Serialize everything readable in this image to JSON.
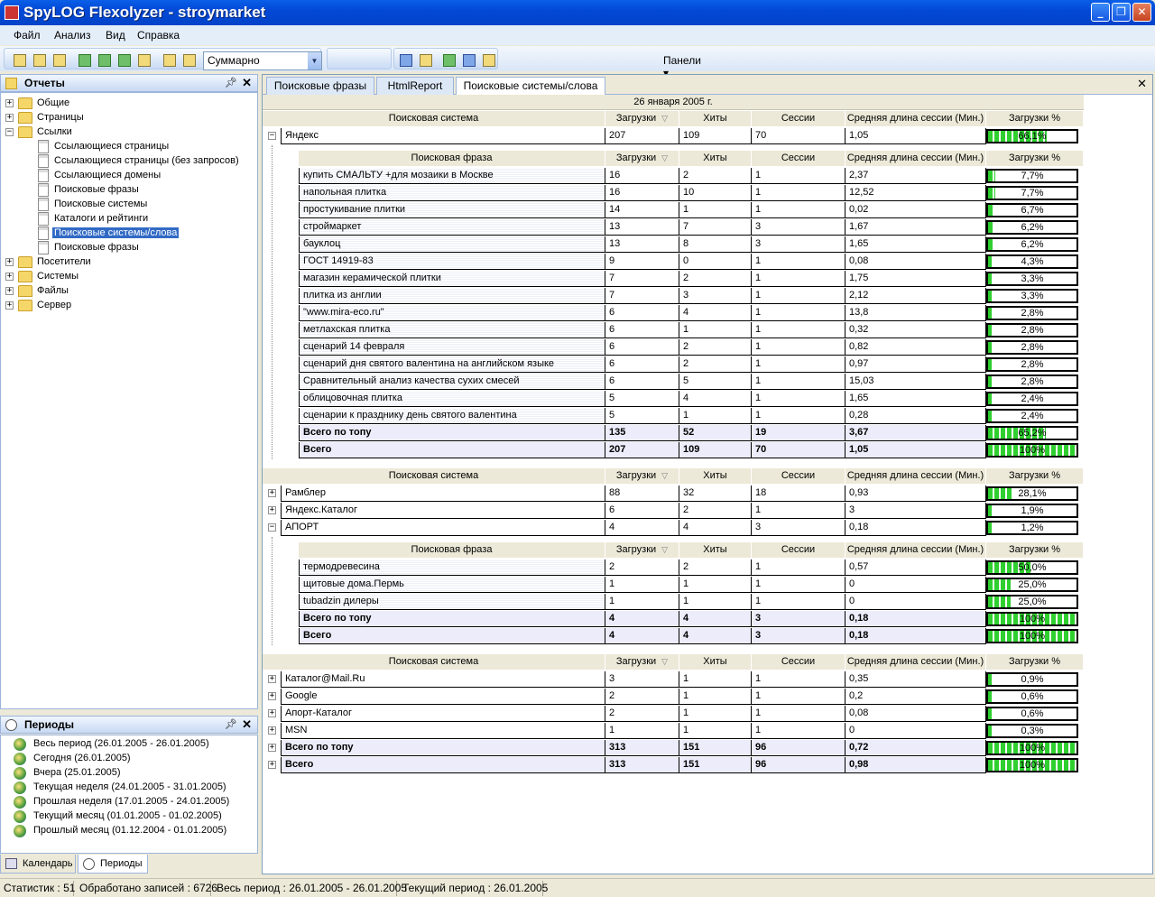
{
  "window": {
    "title": "SpyLOG Flexolyzer - stroymarket",
    "min": "_",
    "max": "❐",
    "close": "✕"
  },
  "menu": [
    "Файл",
    "Анализ",
    "Вид",
    "Справка"
  ],
  "toolbar": {
    "combo_value": "Суммарно",
    "panels_label": "Панели"
  },
  "reports_panel": {
    "title": "Отчеты",
    "tree": [
      {
        "label": "Общие",
        "level": 0,
        "type": "folder",
        "exp": "+"
      },
      {
        "label": "Страницы",
        "level": 0,
        "type": "folder",
        "exp": "+"
      },
      {
        "label": "Ссылки",
        "level": 0,
        "type": "folder",
        "exp": "−"
      },
      {
        "label": "Ссылающиеся страницы",
        "level": 1,
        "type": "doc"
      },
      {
        "label": "Ссылающиеся страницы (без запросов)",
        "level": 1,
        "type": "doc"
      },
      {
        "label": "Ссылающиеся домены",
        "level": 1,
        "type": "doc"
      },
      {
        "label": "Поисковые фразы",
        "level": 1,
        "type": "doc"
      },
      {
        "label": "Поисковые системы",
        "level": 1,
        "type": "doc"
      },
      {
        "label": "Каталоги и рейтинги",
        "level": 1,
        "type": "doc"
      },
      {
        "label": "Поисковые системы/слова",
        "level": 1,
        "type": "doc",
        "selected": true
      },
      {
        "label": "Поисковые фразы",
        "level": 1,
        "type": "doc"
      },
      {
        "label": "Посетители",
        "level": 0,
        "type": "folder",
        "exp": "+"
      },
      {
        "label": "Системы",
        "level": 0,
        "type": "folder",
        "exp": "+"
      },
      {
        "label": "Файлы",
        "level": 0,
        "type": "folder",
        "exp": "+"
      },
      {
        "label": "Сервер",
        "level": 0,
        "type": "folder",
        "exp": "+"
      }
    ]
  },
  "periods_panel": {
    "title": "Периоды",
    "items": [
      "Весь период (26.01.2005 - 26.01.2005)",
      "Сегодня (26.01.2005)",
      "Вчера (25.01.2005)",
      "Текущая неделя (24.01.2005 - 31.01.2005)",
      "Прошлая неделя (17.01.2005 - 24.01.2005)",
      "Текущий месяц (01.01.2005 - 01.02.2005)",
      "Прошлый месяц (01.12.2004 - 01.01.2005)"
    ]
  },
  "bottom_tabs": [
    "Календарь",
    "Периоды"
  ],
  "doc_tabs": [
    "Поисковые фразы",
    "HtmlReport",
    "Поисковые системы/слова"
  ],
  "report": {
    "date": "26 января 2005 г.",
    "headers_system": [
      "Поисковая система",
      "Загрузки",
      "Хиты",
      "Сессии",
      "Средняя длина сессии (Мин.)",
      "Загрузки %"
    ],
    "headers_phrase": [
      "Поисковая фраза",
      "Загрузки",
      "Хиты",
      "Сессии",
      "Средняя длина сессии (Мин.)",
      "Загрузки %"
    ],
    "sections": [
      {
        "systems": [
          {
            "name": "Яндекс",
            "loads": "207",
            "hits": "109",
            "sessions": "70",
            "avg": "1,05",
            "pct": "66,1%",
            "pct_value": 66.1,
            "exp": "−"
          }
        ],
        "phrases": [
          {
            "name": "купить СМАЛЬТУ +для мозаики в Москве",
            "loads": "16",
            "hits": "2",
            "sessions": "1",
            "avg": "2,37",
            "pct": "7,7%",
            "pct_value": 7.7
          },
          {
            "name": "напольная плитка",
            "loads": "16",
            "hits": "10",
            "sessions": "1",
            "avg": "12,52",
            "pct": "7,7%",
            "pct_value": 7.7
          },
          {
            "name": "простукивание плитки",
            "loads": "14",
            "hits": "1",
            "sessions": "1",
            "avg": "0,02",
            "pct": "6,7%",
            "pct_value": 6.7
          },
          {
            "name": "стройм​аркет",
            "loads": "13",
            "hits": "7",
            "sessions": "3",
            "avg": "1,67",
            "pct": "6,2%",
            "pct_value": 6.2
          },
          {
            "name": "бауклоц",
            "loads": "13",
            "hits": "8",
            "sessions": "3",
            "avg": "1,65",
            "pct": "6,2%",
            "pct_value": 6.2
          },
          {
            "name": "ГОСТ 14919-83",
            "loads": "9",
            "hits": "0",
            "sessions": "1",
            "avg": "0,08",
            "pct": "4,3%",
            "pct_value": 4.3
          },
          {
            "name": "магазин керамической плитки",
            "loads": "7",
            "hits": "2",
            "sessions": "1",
            "avg": "1,75",
            "pct": "3,3%",
            "pct_value": 3.3
          },
          {
            "name": "плитка из англии",
            "loads": "7",
            "hits": "3",
            "sessions": "1",
            "avg": "2,12",
            "pct": "3,3%",
            "pct_value": 3.3
          },
          {
            "name": "\"www.mira-eco.ru\"",
            "loads": "6",
            "hits": "4",
            "sessions": "1",
            "avg": "13,8",
            "pct": "2,8%",
            "pct_value": 2.8
          },
          {
            "name": "метлахская плитка",
            "loads": "6",
            "hits": "1",
            "sessions": "1",
            "avg": "0,32",
            "pct": "2,8%",
            "pct_value": 2.8
          },
          {
            "name": "сценарий 14 февраля",
            "loads": "6",
            "hits": "2",
            "sessions": "1",
            "avg": "0,82",
            "pct": "2,8%",
            "pct_value": 2.8
          },
          {
            "name": "сценарий дня святого валентина на английском языке",
            "loads": "6",
            "hits": "2",
            "sessions": "1",
            "avg": "0,97",
            "pct": "2,8%",
            "pct_value": 2.8
          },
          {
            "name": "Сравнительный анализ качества сухих смесей",
            "loads": "6",
            "hits": "5",
            "sessions": "1",
            "avg": "15,03",
            "pct": "2,8%",
            "pct_value": 2.8
          },
          {
            "name": "облицовочная плитка",
            "loads": "5",
            "hits": "4",
            "sessions": "1",
            "avg": "1,65",
            "pct": "2,4%",
            "pct_value": 2.4
          },
          {
            "name": "сценарии к празднику день святого валентина",
            "loads": "5",
            "hits": "1",
            "sessions": "1",
            "avg": "0,28",
            "pct": "2,4%",
            "pct_value": 2.4
          },
          {
            "name": "Всего по топу",
            "loads": "135",
            "hits": "52",
            "sessions": "19",
            "avg": "3,67",
            "pct": "65,2%",
            "pct_value": 65.2,
            "total": true
          },
          {
            "name": "Всего",
            "loads": "207",
            "hits": "109",
            "sessions": "70",
            "avg": "1,05",
            "pct": "100%",
            "pct_value": 100,
            "total": true
          }
        ]
      },
      {
        "systems": [
          {
            "name": "Рамблер",
            "loads": "88",
            "hits": "32",
            "sessions": "18",
            "avg": "0,93",
            "pct": "28,1%",
            "pct_value": 28.1,
            "exp": "+"
          },
          {
            "name": "Яндекс.Каталог",
            "loads": "6",
            "hits": "2",
            "sessions": "1",
            "avg": "3",
            "pct": "1,9%",
            "pct_value": 1.9,
            "exp": "+"
          },
          {
            "name": "АПОРТ",
            "loads": "4",
            "hits": "4",
            "sessions": "3",
            "avg": "0,18",
            "pct": "1,2%",
            "pct_value": 1.2,
            "exp": "−"
          }
        ],
        "phrases": [
          {
            "name": "термодревесина",
            "loads": "2",
            "hits": "2",
            "sessions": "1",
            "avg": "0,57",
            "pct": "50,0%",
            "pct_value": 50
          },
          {
            "name": "щитовые дома.Пермь",
            "loads": "1",
            "hits": "1",
            "sessions": "1",
            "avg": "0",
            "pct": "25,0%",
            "pct_value": 25
          },
          {
            "name": "tubadzin дилеры",
            "loads": "1",
            "hits": "1",
            "sessions": "1",
            "avg": "0",
            "pct": "25,0%",
            "pct_value": 25
          },
          {
            "name": "Всего по топу",
            "loads": "4",
            "hits": "4",
            "sessions": "3",
            "avg": "0,18",
            "pct": "100%",
            "pct_value": 100,
            "total": true
          },
          {
            "name": "Всего",
            "loads": "4",
            "hits": "4",
            "sessions": "3",
            "avg": "0,18",
            "pct": "100%",
            "pct_value": 100,
            "total": true
          }
        ]
      },
      {
        "systems": [
          {
            "name": "Каталог@Mail.Ru",
            "loads": "3",
            "hits": "1",
            "sessions": "1",
            "avg": "0,35",
            "pct": "0,9%",
            "pct_value": 0.9,
            "exp": "+"
          },
          {
            "name": "Google",
            "loads": "2",
            "hits": "1",
            "sessions": "1",
            "avg": "0,2",
            "pct": "0,6%",
            "pct_value": 0.6,
            "exp": "+"
          },
          {
            "name": "Апорт-Каталог",
            "loads": "2",
            "hits": "1",
            "sessions": "1",
            "avg": "0,08",
            "pct": "0,6%",
            "pct_value": 0.6,
            "exp": "+"
          },
          {
            "name": "MSN",
            "loads": "1",
            "hits": "1",
            "sessions": "1",
            "avg": "0",
            "pct": "0,3%",
            "pct_value": 0.3,
            "exp": "+"
          },
          {
            "name": "Всего по топу",
            "loads": "313",
            "hits": "151",
            "sessions": "96",
            "avg": "0,72",
            "pct": "100%",
            "pct_value": 100,
            "exp": "+",
            "total": true
          },
          {
            "name": "Всего",
            "loads": "313",
            "hits": "151",
            "sessions": "96",
            "avg": "0,98",
            "pct": "100%",
            "pct_value": 100,
            "exp": "+",
            "total": true
          }
        ],
        "phrases": []
      }
    ]
  },
  "statusbar": [
    "Статистик : 51",
    "Обработано записей : 6726",
    "Весь период : 26.01.2005 - 26.01.2005",
    "Текущий период : 26.01.2005"
  ]
}
